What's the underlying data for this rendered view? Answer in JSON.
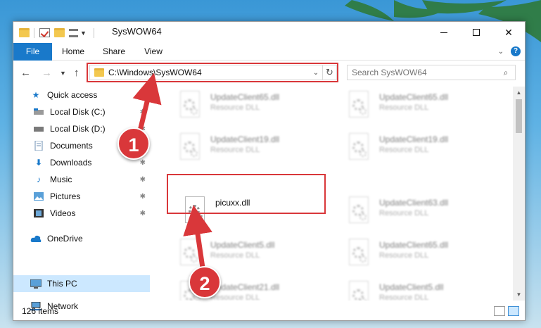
{
  "window": {
    "title": "SysWOW64"
  },
  "ribbon": {
    "tabs": [
      "File",
      "Home",
      "Share",
      "View"
    ],
    "help": "?"
  },
  "nav": {
    "back_icon": "left-arrow-icon",
    "forward_icon": "right-arrow-icon",
    "address": "C:\\Windows\\SysWOW64",
    "search_placeholder": "Search SysWOW64"
  },
  "sidebar": {
    "items": [
      {
        "label": "Quick access",
        "icon": "star-icon"
      },
      {
        "label": "Local Disk (C:)",
        "icon": "drive-icon"
      },
      {
        "label": "Local Disk (D:)",
        "icon": "drive-icon"
      },
      {
        "label": "Documents",
        "icon": "documents-icon"
      },
      {
        "label": "Downloads",
        "icon": "downloads-icon"
      },
      {
        "label": "Music",
        "icon": "music-icon"
      },
      {
        "label": "Pictures",
        "icon": "pictures-icon"
      },
      {
        "label": "Videos",
        "icon": "videos-icon"
      },
      {
        "label": "OneDrive",
        "icon": "cloud-icon"
      },
      {
        "label": "This PC",
        "icon": "computer-icon",
        "selected": true
      },
      {
        "label": "Network",
        "icon": "network-icon"
      }
    ]
  },
  "files": [
    {
      "name": "UpdateClient65.dll",
      "type": "Resource DLL"
    },
    {
      "name": "UpdateClient65.dll",
      "type": "Resource DLL"
    },
    {
      "name": "UpdateClient19.dll",
      "type": "Resource DLL"
    },
    {
      "name": "UpdateClient19.dll",
      "type": "Resource DLL"
    },
    {
      "name": "picuxx.dll",
      "type": ""
    },
    {
      "name": "UpdateClient63.dll",
      "type": "Resource DLL"
    },
    {
      "name": "UpdateClient5.dll",
      "type": "Resource DLL"
    },
    {
      "name": "UpdateClient65.dll",
      "type": "Resource DLL"
    },
    {
      "name": "UpdateClient21.dll",
      "type": "Resource DLL"
    },
    {
      "name": "UpdateClient5.dll",
      "type": "Resource DLL"
    }
  ],
  "status": {
    "item_count": "126 items"
  },
  "callouts": {
    "one": "1",
    "two": "2"
  },
  "colors": {
    "accent": "#1979ca",
    "highlight": "#d9373a",
    "selected": "#cce8ff"
  }
}
